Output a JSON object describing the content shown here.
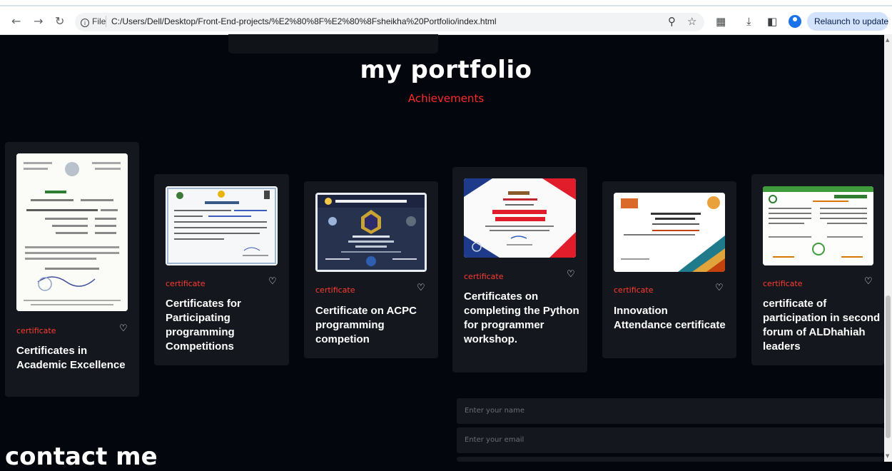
{
  "browser": {
    "file_label": "File",
    "url": "C:/Users/Dell/Desktop/Front-End-projects/%E2%80%8F%E2%80%8Fsheikha%20Portfolio/index.html",
    "relaunch_label": "Relaunch to update"
  },
  "portfolio": {
    "title": "my portfolio",
    "subtitle": "Achievements",
    "cards": [
      {
        "category": "certificate",
        "title": "Certificates in Academic Excellence"
      },
      {
        "category": "certificate",
        "title": "Certificates for Participating programming Competitions"
      },
      {
        "category": "certificate",
        "title": "Certificate on ACPC programming competion"
      },
      {
        "category": "certificate",
        "title": "Certificates on completing the Python for programmer workshop."
      },
      {
        "category": "certificate",
        "title": "Innovation Attendance certificate"
      },
      {
        "category": "certificate",
        "title": "certificate of participation in second forum of ALDhahiah leaders"
      }
    ]
  },
  "contact": {
    "title": "contact me",
    "name_placeholder": "Enter your name",
    "email_placeholder": "Enter your email"
  },
  "colors": {
    "accent": "#ff2a2a",
    "background": "#04060e",
    "card": "#14171d"
  }
}
